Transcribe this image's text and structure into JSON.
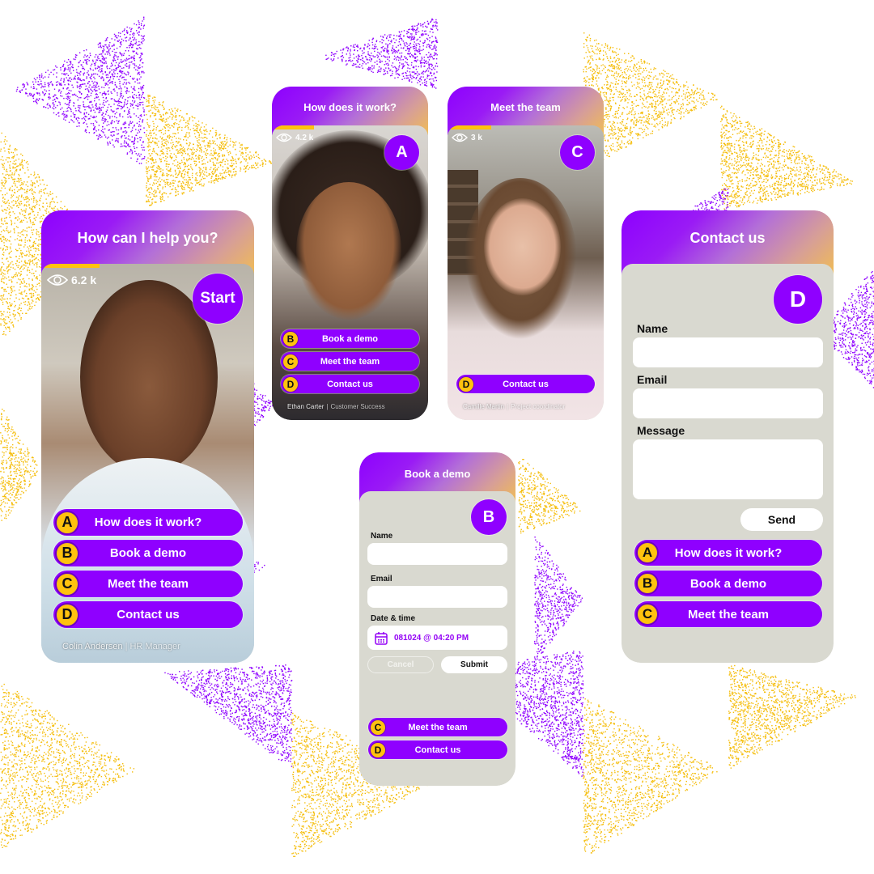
{
  "brand": {
    "primary": "#8f00ff",
    "accent": "#ffc20e",
    "form_bg": "#d9d9d0"
  },
  "cards": {
    "start": {
      "title": "How can I help you?",
      "views": "6.2 k",
      "badge": "Start",
      "progress": 0.28,
      "options": [
        {
          "letter": "A",
          "label": "How does it work?"
        },
        {
          "letter": "B",
          "label": "Book a demo"
        },
        {
          "letter": "C",
          "label": "Meet the team"
        },
        {
          "letter": "D",
          "label": "Contact us"
        }
      ],
      "person_name": "Colin Andersen",
      "person_role": "HR Manager"
    },
    "a": {
      "title": "How does it work?",
      "views": "4.2 k",
      "badge": "A",
      "progress": 0.27,
      "options": [
        {
          "letter": "B",
          "label": "Book a demo"
        },
        {
          "letter": "C",
          "label": "Meet the team"
        },
        {
          "letter": "D",
          "label": "Contact us"
        }
      ],
      "person_name": "Ethan Carter",
      "person_role": "Customer Success"
    },
    "c": {
      "title": "Meet the team",
      "views": "3 k",
      "badge": "C",
      "progress": 0.28,
      "options": [
        {
          "letter": "D",
          "label": "Contact us"
        }
      ],
      "person_name": "Camille Martin",
      "person_role": "Project coordinator"
    },
    "b": {
      "title": "Book a demo",
      "badge": "B",
      "fields": {
        "name_label": "Name",
        "name_value": "",
        "email_label": "Email",
        "email_value": "",
        "datetime_label": "Date & time",
        "datetime_value": "081024 @ 04:20 PM"
      },
      "cancel_label": "Cancel",
      "submit_label": "Submit",
      "options": [
        {
          "letter": "C",
          "label": "Meet the team"
        },
        {
          "letter": "D",
          "label": "Contact us"
        }
      ]
    },
    "d": {
      "title": "Contact us",
      "badge": "D",
      "fields": {
        "name_label": "Name",
        "name_value": "",
        "email_label": "Email",
        "email_value": "",
        "message_label": "Message",
        "message_value": ""
      },
      "send_label": "Send",
      "options": [
        {
          "letter": "A",
          "label": "How does it work?"
        },
        {
          "letter": "B",
          "label": "Book a demo"
        },
        {
          "letter": "C",
          "label": "Meet the team"
        }
      ]
    }
  }
}
